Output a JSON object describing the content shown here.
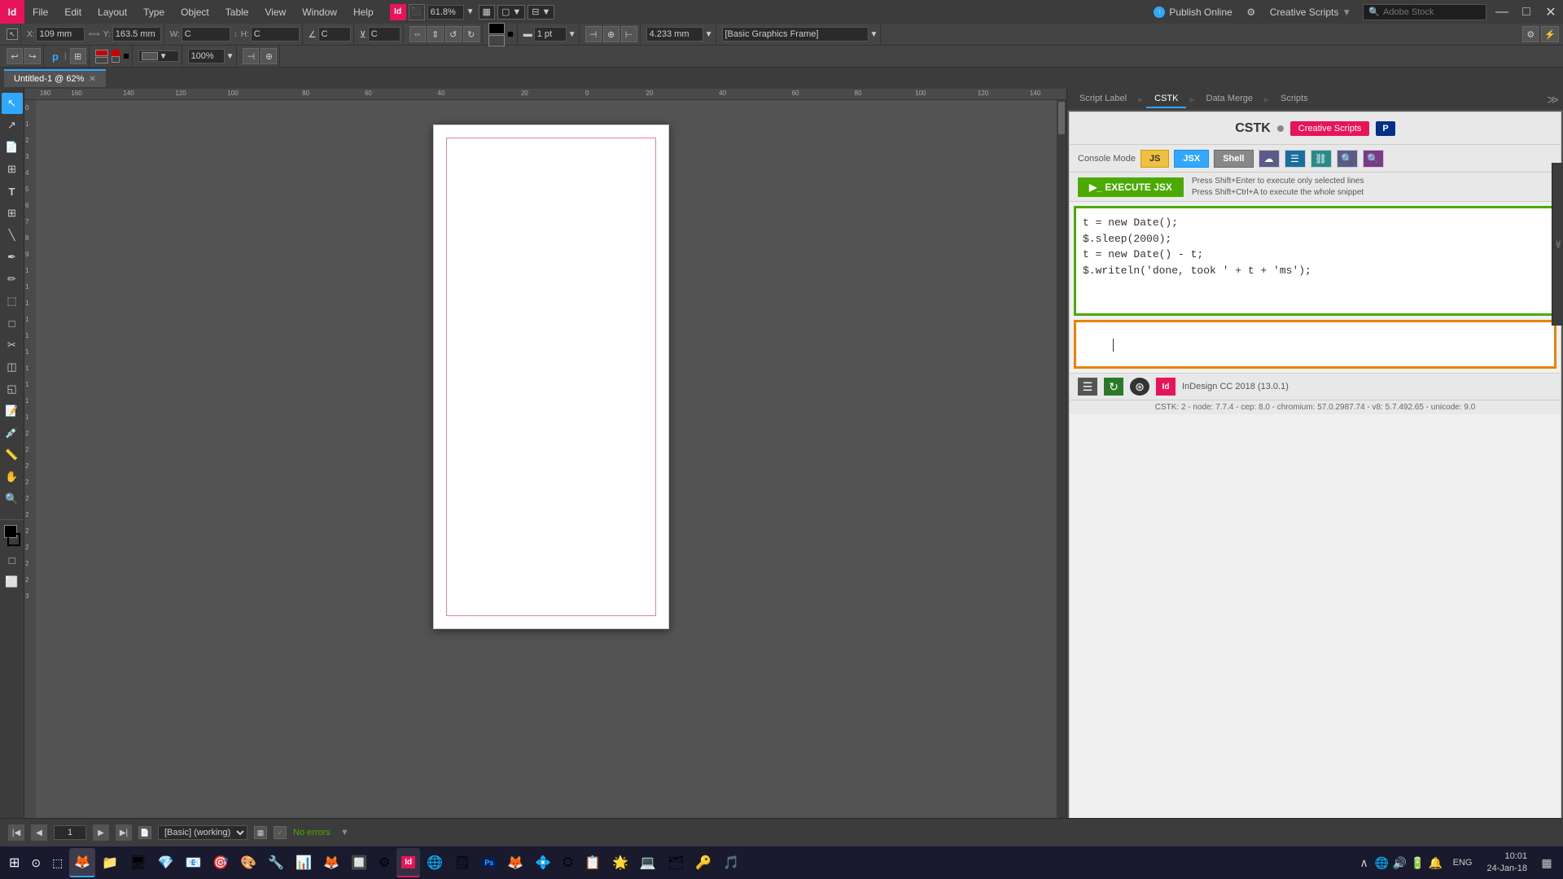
{
  "app": {
    "title": "InDesign",
    "icon_letter": "Id",
    "tab_label": "Untitled-1 @ 62%",
    "tab_active": true
  },
  "menu": {
    "items": [
      "File",
      "Edit",
      "Layout",
      "Type",
      "Object",
      "Table",
      "View",
      "Window",
      "Help"
    ],
    "zoom_percent": "61.8%",
    "publish_online": "Publish Online",
    "creative_scripts": "Creative Scripts",
    "adobe_stock_placeholder": "Adobe Stock",
    "frame_style": "[Basic Graphics Frame]"
  },
  "toolbar": {
    "x_label": "X:",
    "x_value": "109 mm",
    "y_label": "Y:",
    "y_value": "163.5 mm",
    "w_label": "W:",
    "h_label": "H:",
    "w_value": "C",
    "h_value": "C",
    "pt_value": "1 pt",
    "pct_value": "100%",
    "coord_value": "4.233 mm"
  },
  "panel": {
    "tabs": [
      "Script Label",
      "CSTK",
      "Data Merge",
      "Scripts"
    ],
    "active_tab": "CSTK",
    "title": "CSTK",
    "creative_scripts_btn": "Creative Scripts",
    "paypal_letter": "P",
    "console_label": "Console Mode",
    "modes": [
      "JS",
      "JSX",
      "Shell"
    ],
    "active_mode": "JSX",
    "execute_btn": "▶_ EXECUTE JSX",
    "hint_line1": "Press Shift+Enter to execute only selected lines",
    "hint_line2": "Press Shift+Ctrl+A to execute the whole snippet",
    "code": "t = new Date();\n$.sleep(2000);\nt = new Date() - t;\n$.writeln('done, took ' + t + 'ms');",
    "output_cursor_char": "I",
    "version_label": "InDesign CC 2018 (13.0.1)",
    "version_detail": "CSTK: 2 - node: 7.7.4 - cep: 8.0 - chromium: 57.0.2987.74 - v8: 5.7.492.65 - unicode: 9.0"
  },
  "statusbar": {
    "page_num": "1",
    "layout_label": "[Basic] (working)",
    "status_text": "No errors"
  },
  "taskbar": {
    "time": "10:01",
    "date": "24-Jan-18",
    "language": "ENG",
    "start_icon": "⊞",
    "apps": [
      "⊡",
      "◎",
      "▦",
      "🦊",
      "📁",
      "🖥",
      "♦",
      "📧",
      "🎯",
      "🎨",
      "🔧",
      "📊",
      "🌐",
      "🗒",
      "🔲",
      "⚙"
    ]
  }
}
